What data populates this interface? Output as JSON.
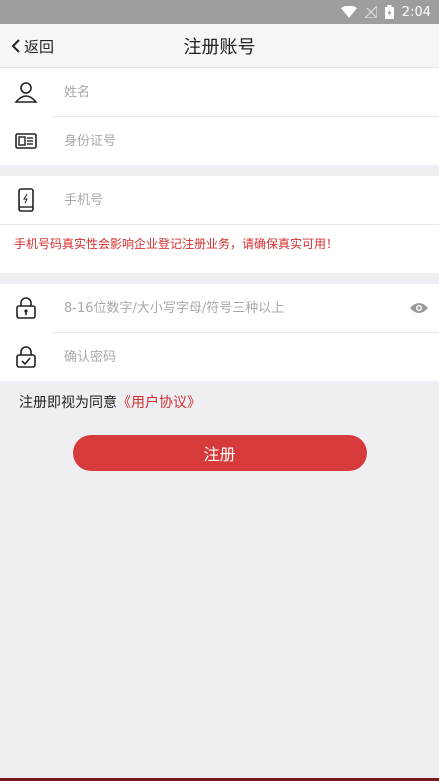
{
  "status": {
    "time": "2:04"
  },
  "header": {
    "back_label": "返回",
    "title": "注册账号"
  },
  "form": {
    "name_placeholder": "姓名",
    "id_placeholder": "身份证号",
    "phone_placeholder": "手机号",
    "phone_warning": "手机号码真实性会影响企业登记注册业务，请确保真实可用！",
    "password_placeholder": "8-16位数字/大小写字母/符号三种以上",
    "confirm_placeholder": "确认密码"
  },
  "agreement": {
    "prefix": "注册即视为同意",
    "link": "《用户协议》"
  },
  "submit_label": "注册",
  "colors": {
    "accent": "#d63a3a",
    "warning": "#d32f2f"
  }
}
